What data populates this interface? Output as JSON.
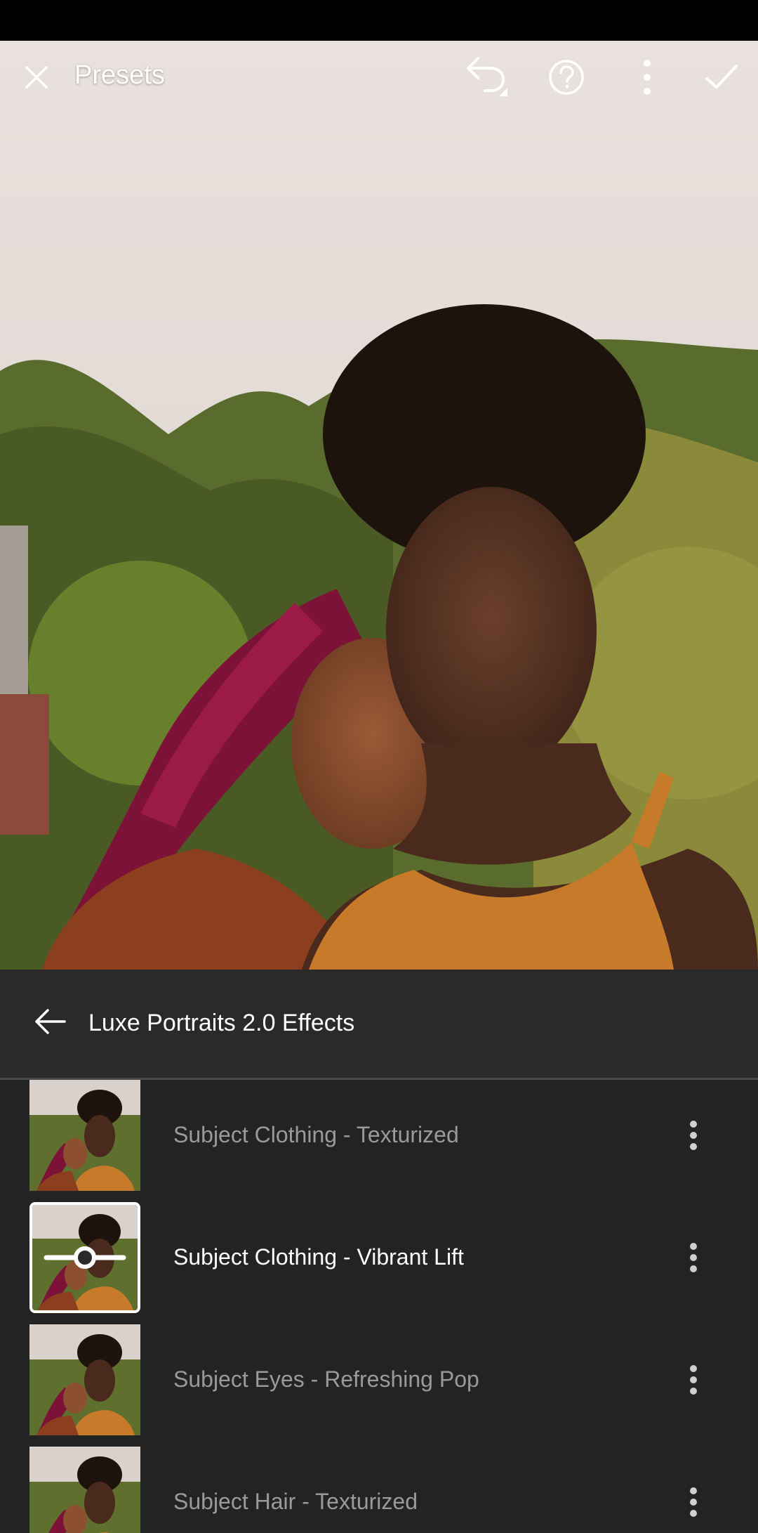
{
  "toolbar": {
    "title": "Presets",
    "close_icon": "close-icon",
    "undo_icon": "undo-icon",
    "help_icon": "help-icon",
    "more_icon": "more-vertical-icon",
    "done_icon": "checkmark-icon"
  },
  "panel": {
    "back_icon": "arrow-left-icon",
    "title": "Luxe Portraits 2.0 Effects",
    "presets": [
      {
        "label": "Subject Clothing - Texturized",
        "active": false
      },
      {
        "label": "Subject Clothing - Vibrant Lift",
        "active": true
      },
      {
        "label": "Subject Eyes - Refreshing Pop",
        "active": false
      },
      {
        "label": "Subject Hair - Texturized",
        "active": false
      }
    ]
  },
  "colors": {
    "panel_bg": "#232323",
    "panel_header_bg": "#2a2a2a",
    "active_text": "#ffffff",
    "inactive_text": "#9a9a9a"
  }
}
